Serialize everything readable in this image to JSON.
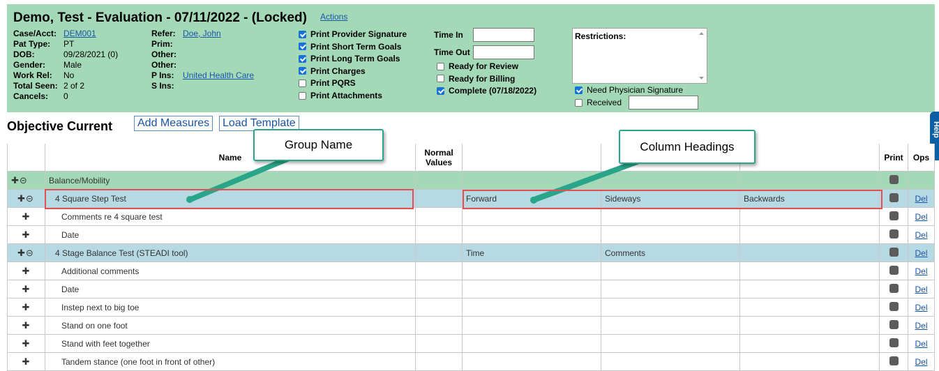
{
  "header": {
    "title": "Demo, Test - Evaluation - 07/11/2022 - (Locked)",
    "actions": "Actions",
    "patient": [
      {
        "label": "Case/Acct:",
        "value": "DEM001",
        "link": true
      },
      {
        "label": "Pat Type:",
        "value": "PT"
      },
      {
        "label": "DOB:",
        "value": "09/28/2021 (0)"
      },
      {
        "label": "Gender:",
        "value": "Male"
      },
      {
        "label": "Work Rel:",
        "value": "No"
      },
      {
        "label": "Total Seen:",
        "value": "2 of 2"
      },
      {
        "label": "Cancels:",
        "value": "0"
      }
    ],
    "referral": [
      {
        "label": "Refer:",
        "value": "Doe, John",
        "link": true
      },
      {
        "label": "Prim:",
        "value": ""
      },
      {
        "label": "Other:",
        "value": ""
      },
      {
        "label": "Other:",
        "value": ""
      },
      {
        "label": "P Ins:",
        "value": "United Health Care",
        "link": true
      },
      {
        "label": "S Ins:",
        "value": ""
      }
    ],
    "print_options": [
      {
        "label": "Print Provider Signature",
        "checked": true
      },
      {
        "label": "Print Short Term Goals",
        "checked": true
      },
      {
        "label": "Print Long Term Goals",
        "checked": true
      },
      {
        "label": "Print Charges",
        "checked": true
      },
      {
        "label": "Print PQRS",
        "checked": false
      },
      {
        "label": "Print Attachments",
        "checked": false
      }
    ],
    "time_in_label": "Time In",
    "time_out_label": "Time Out",
    "time_in_value": "",
    "time_out_value": "",
    "status_options": [
      {
        "label": "Ready for Review",
        "checked": false
      },
      {
        "label": "Ready for Billing",
        "checked": false
      },
      {
        "label": "Complete (07/18/2022)",
        "checked": true
      }
    ],
    "restrictions_label": "Restrictions:",
    "restrictions_value": "",
    "need_signature": {
      "label": "Need Physician Signature",
      "checked": true
    },
    "received": {
      "label": "Received",
      "checked": false,
      "value": ""
    }
  },
  "section": {
    "title": "Objective Current",
    "add_measures": "Add Measures",
    "load_template": "Load Template"
  },
  "help_tab": "Help",
  "table": {
    "headers": {
      "name": "Name",
      "normal": "Normal\nValues",
      "print": "Print",
      "ops": "Ops"
    },
    "rows": [
      {
        "type": "group",
        "ops": "✚⊝",
        "name": "Balance/Mobility",
        "normal": "",
        "c1": "",
        "c2": "",
        "c3": "",
        "del": ""
      },
      {
        "type": "test",
        "ops": "✚⊝",
        "name": "4 Square Step Test",
        "normal": "",
        "c1": "Forward",
        "c2": "Sideways",
        "c3": "Backwards",
        "del": "Del"
      },
      {
        "type": "item",
        "ops": "✚",
        "name": "Comments re 4 square test",
        "normal": "",
        "c1": "",
        "c2": "",
        "c3": "",
        "del": "Del"
      },
      {
        "type": "item",
        "ops": "✚",
        "name": "Date",
        "normal": "",
        "c1": "",
        "c2": "",
        "c3": "",
        "del": "Del"
      },
      {
        "type": "test",
        "ops": "✚⊝",
        "name": "4 Stage Balance Test (STEADI tool)",
        "normal": "",
        "c1": "Time",
        "c2": "Comments",
        "c3": "",
        "del": "Del"
      },
      {
        "type": "item",
        "ops": "✚",
        "name": "Additional comments",
        "normal": "",
        "c1": "",
        "c2": "",
        "c3": "",
        "del": "Del"
      },
      {
        "type": "item",
        "ops": "✚",
        "name": "Date",
        "normal": "",
        "c1": "",
        "c2": "",
        "c3": "",
        "del": "Del"
      },
      {
        "type": "item",
        "ops": "✚",
        "name": "Instep next to big toe",
        "normal": "",
        "c1": "",
        "c2": "",
        "c3": "",
        "del": "Del"
      },
      {
        "type": "item",
        "ops": "✚",
        "name": "Stand on one foot",
        "normal": "",
        "c1": "",
        "c2": "",
        "c3": "",
        "del": "Del"
      },
      {
        "type": "item",
        "ops": "✚",
        "name": "Stand with feet together",
        "normal": "",
        "c1": "",
        "c2": "",
        "c3": "",
        "del": "Del"
      },
      {
        "type": "item",
        "ops": "✚",
        "name": "Tandem stance (one foot in front of other)",
        "normal": "",
        "c1": "",
        "c2": "",
        "c3": "",
        "del": "Del"
      }
    ]
  },
  "callouts": {
    "group_name": "Group Name",
    "column_headings": "Column Headings"
  },
  "colors": {
    "header_bg": "#a3d9b6",
    "group_row": "#a3d9b6",
    "test_row": "#b7d9e3",
    "callout_border": "#2aa58a",
    "highlight": "#e05050",
    "link": "#1a55a8"
  }
}
